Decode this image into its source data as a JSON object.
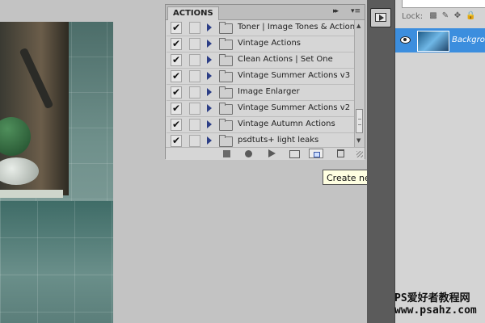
{
  "actions_panel": {
    "tab_label": "ACTIONS",
    "collapse_glyph": "▸▸",
    "menu_glyph": "▾≡",
    "items": [
      {
        "label": "Toner | Image Tones & Actions",
        "checked": true
      },
      {
        "label": "Vintage Actions",
        "checked": true
      },
      {
        "label": "Clean Actions | Set One",
        "checked": true
      },
      {
        "label": "Vintage Summer Actions v3",
        "checked": true
      },
      {
        "label": "Image Enlarger",
        "checked": true
      },
      {
        "label": "Vintage Summer Actions v2",
        "checked": true
      },
      {
        "label": "Vintage Autumn Actions",
        "checked": true
      },
      {
        "label": "psdtuts+ light leaks",
        "checked": true
      }
    ],
    "check_glyph": "✔",
    "footer_buttons": [
      "stop-icon",
      "record-icon",
      "play-icon",
      "new-set-icon",
      "new-action-icon",
      "trash-icon"
    ]
  },
  "tooltip": {
    "text": "Create new action"
  },
  "layers_panel": {
    "lock_label": "Lock:",
    "lock_icons": [
      "▩",
      "✎",
      "✥",
      "🔒"
    ],
    "layer_name": "Background"
  },
  "watermark": {
    "line1": "PS爱好者教程网",
    "line2": "www.psahz.com"
  },
  "colors": {
    "accent": "#3c8ede",
    "panel_bg": "#d6d6d6",
    "tooltip_bg": "#ffffe1"
  }
}
